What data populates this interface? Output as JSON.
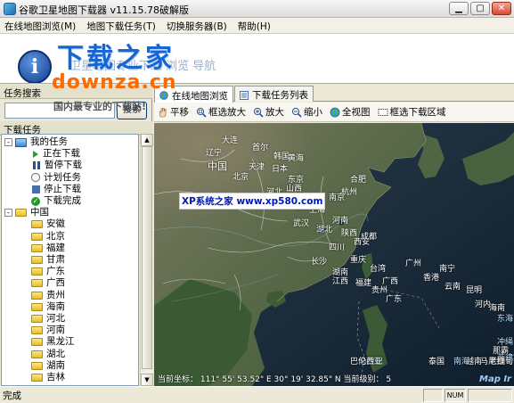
{
  "window": {
    "title": "谷歌卫星地图下载器 v11.15.78破解版",
    "buttons": [
      "minimize",
      "maximize",
      "close"
    ]
  },
  "menu": [
    {
      "label": "在线地图浏览(M)"
    },
    {
      "label": "地图下载任务(T)"
    },
    {
      "label": "切换服务器(B)"
    },
    {
      "label": "帮助(H)"
    }
  ],
  "banner": {
    "tagline": "卫星地图专业下载 浏览 导航"
  },
  "watermarks": {
    "site_cn": "下载之家",
    "site_en": "downza.cn",
    "slogan": "国内最专业的下载站!",
    "xp": "XP系统之家 www.xp580.com"
  },
  "left": {
    "search_header": "任务搜索",
    "search": {
      "value": "",
      "button": "搜索"
    },
    "tasks_header": "下载任务",
    "tree": [
      {
        "label": "我的任务",
        "level": 0,
        "expander": "-",
        "icon": "computer-icon"
      },
      {
        "label": "正在下载",
        "level": 1,
        "icon": "play-icon"
      },
      {
        "label": "暂停下载",
        "level": 1,
        "icon": "pause-icon"
      },
      {
        "label": "计划任务",
        "level": 1,
        "icon": "clock-icon"
      },
      {
        "label": "停止下载",
        "level": 1,
        "icon": "stop-icon"
      },
      {
        "label": "下载完成",
        "level": 1,
        "icon": "check-icon"
      },
      {
        "label": "中国",
        "level": 0,
        "expander": "-",
        "icon": "folder-icon"
      },
      {
        "label": "安徽",
        "level": 1,
        "icon": "folder-icon"
      },
      {
        "label": "北京",
        "level": 1,
        "icon": "folder-icon"
      },
      {
        "label": "福建",
        "level": 1,
        "icon": "folder-icon"
      },
      {
        "label": "甘肃",
        "level": 1,
        "icon": "folder-icon"
      },
      {
        "label": "广东",
        "level": 1,
        "icon": "folder-icon"
      },
      {
        "label": "广西",
        "level": 1,
        "icon": "folder-icon"
      },
      {
        "label": "贵州",
        "level": 1,
        "icon": "folder-icon"
      },
      {
        "label": "海南",
        "level": 1,
        "icon": "folder-icon"
      },
      {
        "label": "河北",
        "level": 1,
        "icon": "folder-icon"
      },
      {
        "label": "河南",
        "level": 1,
        "icon": "folder-icon"
      },
      {
        "label": "黑龙江",
        "level": 1,
        "icon": "folder-icon"
      },
      {
        "label": "湖北",
        "level": 1,
        "icon": "folder-icon"
      },
      {
        "label": "湖南",
        "level": 1,
        "icon": "folder-icon"
      },
      {
        "label": "吉林",
        "level": 1,
        "icon": "folder-icon"
      }
    ]
  },
  "tabs": [
    {
      "label": "在线地图浏览",
      "active": true,
      "icon": "globe-icon"
    },
    {
      "label": "下载任务列表",
      "active": false,
      "icon": "list-icon"
    }
  ],
  "toolbar": [
    {
      "label": "平移",
      "icon": "pan-hand-icon"
    },
    {
      "label": "框选放大",
      "icon": "box-zoom-icon"
    },
    {
      "label": "放大",
      "icon": "zoom-in-icon"
    },
    {
      "label": "缩小",
      "icon": "zoom-out-icon"
    },
    {
      "label": "全视图",
      "icon": "globe-icon"
    },
    {
      "label": "框选下载区域",
      "icon": "select-region-icon"
    }
  ],
  "map": {
    "labels": [
      {
        "text": "中国",
        "size": "big"
      },
      {
        "text": "北京"
      },
      {
        "text": "天津"
      },
      {
        "text": "辽宁"
      },
      {
        "text": "大连"
      },
      {
        "text": "韩国"
      },
      {
        "text": "首尔"
      },
      {
        "text": "黄海"
      },
      {
        "text": "日本"
      },
      {
        "text": "东京"
      },
      {
        "text": "山西"
      },
      {
        "text": "河北"
      },
      {
        "text": "济南"
      },
      {
        "text": "山东"
      },
      {
        "text": "南京"
      },
      {
        "text": "上海"
      },
      {
        "text": "杭州"
      },
      {
        "text": "合肥"
      },
      {
        "text": "武汉"
      },
      {
        "text": "湖北"
      },
      {
        "text": "河南"
      },
      {
        "text": "陕西"
      },
      {
        "text": "西安"
      },
      {
        "text": "成都"
      },
      {
        "text": "四川"
      },
      {
        "text": "重庆"
      },
      {
        "text": "长沙"
      },
      {
        "text": "湖南"
      },
      {
        "text": "江西"
      },
      {
        "text": "福建"
      },
      {
        "text": "台湾"
      },
      {
        "text": "贵州"
      },
      {
        "text": "广西"
      },
      {
        "text": "广东"
      },
      {
        "text": "广州"
      },
      {
        "text": "香港"
      },
      {
        "text": "南宁"
      },
      {
        "text": "云南"
      },
      {
        "text": "昆明"
      },
      {
        "text": "河内"
      },
      {
        "text": "海南"
      },
      {
        "text": "东海",
        "sea": true
      },
      {
        "text": "冲绳",
        "sea": true
      },
      {
        "text": "那霸"
      },
      {
        "text": "菲律宾海",
        "sea": true
      },
      {
        "text": "马尼拉"
      },
      {
        "text": "越南"
      },
      {
        "text": "老挝"
      },
      {
        "text": "缅甸"
      },
      {
        "text": "泰国"
      },
      {
        "text": "南海",
        "sea": true
      },
      {
        "text": "马拉巴",
        "sea": true
      },
      {
        "text": "巴伦西亚"
      }
    ],
    "coords": "当前坐标： 111° 55' 53.52\" E  30° 19' 32.85\" N  当前级别： 5",
    "attribution": "Map Ir"
  },
  "status": {
    "text": "完成",
    "panels": [
      "",
      "NUM",
      ""
    ]
  }
}
